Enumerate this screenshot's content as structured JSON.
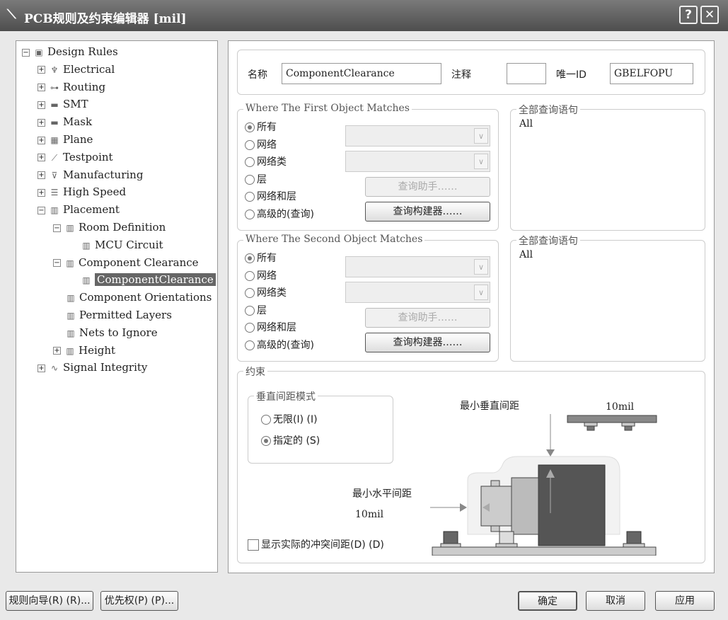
{
  "window": {
    "title": "PCB规则及约束编辑器 [mil]",
    "help": "?",
    "close": "✕"
  },
  "tree": [
    {
      "label": "Design Rules",
      "icon": "design-rules-icon",
      "level": 0,
      "exp": "−"
    },
    {
      "label": "Electrical",
      "icon": "electrical-icon",
      "level": 1,
      "exp": "+"
    },
    {
      "label": "Routing",
      "icon": "routing-icon",
      "level": 1,
      "exp": "+"
    },
    {
      "label": "SMT",
      "icon": "smt-icon",
      "level": 1,
      "exp": "+"
    },
    {
      "label": "Mask",
      "icon": "mask-icon",
      "level": 1,
      "exp": "+"
    },
    {
      "label": "Plane",
      "icon": "plane-icon",
      "level": 1,
      "exp": "+"
    },
    {
      "label": "Testpoint",
      "icon": "testpoint-icon",
      "level": 1,
      "exp": "+"
    },
    {
      "label": "Manufacturing",
      "icon": "manufacturing-icon",
      "level": 1,
      "exp": "+"
    },
    {
      "label": "High Speed",
      "icon": "high-speed-icon",
      "level": 1,
      "exp": "+"
    },
    {
      "label": "Placement",
      "icon": "placement-icon",
      "level": 1,
      "exp": "−"
    },
    {
      "label": "Room Definition",
      "icon": "chip-icon",
      "level": 2,
      "exp": "−"
    },
    {
      "label": "MCU Circuit",
      "icon": "chip-icon",
      "level": 3,
      "exp": ""
    },
    {
      "label": "Component Clearance",
      "icon": "chip-icon",
      "level": 2,
      "exp": "−"
    },
    {
      "label": "ComponentClearance",
      "icon": "chip-icon",
      "level": 3,
      "exp": "",
      "selected": true
    },
    {
      "label": "Component Orientations",
      "icon": "chip-icon",
      "level": 2,
      "exp": ""
    },
    {
      "label": "Permitted Layers",
      "icon": "chip-icon",
      "level": 2,
      "exp": ""
    },
    {
      "label": "Nets to Ignore",
      "icon": "chip-icon",
      "level": 2,
      "exp": ""
    },
    {
      "label": "Height",
      "icon": "chip-icon",
      "level": 2,
      "exp": "+"
    },
    {
      "label": "Signal Integrity",
      "icon": "signal-integrity-icon",
      "level": 1,
      "exp": "+"
    }
  ],
  "rule": {
    "name_label": "名称",
    "name": "ComponentClearance",
    "comment_label": "注释",
    "comment": "",
    "id_label": "唯一ID",
    "id": "GBELFOPU"
  },
  "first": {
    "title": "Where The First Object Matches",
    "options": [
      "所有",
      "网络",
      "网络类",
      "层",
      "网络和层",
      "高级的(查询)"
    ],
    "helper": "查询助手……",
    "builder": "查询构建器……",
    "query_title": "全部查询语句",
    "query": "All"
  },
  "second": {
    "title": "Where The Second Object Matches",
    "options": [
      "所有",
      "网络",
      "网络类",
      "层",
      "网络和层",
      "高级的(查询)"
    ],
    "helper": "查询助手……",
    "builder": "查询构建器……",
    "query_title": "全部查询语句",
    "query": "All"
  },
  "constraint": {
    "title": "约束",
    "mode_title": "垂直间距模式",
    "infinite": "无限(I) (I)",
    "specified": "指定的 (S)",
    "min_vertical": "最小垂直间距",
    "vertical_value": "10mil",
    "min_horizontal": "最小水平间距",
    "horizontal_value": "10mil",
    "show_actual": "显示实际的冲突间距(D) (D)"
  },
  "buttons": {
    "wizard": "规则向导(R) (R)...",
    "priority": "优先权(P) (P)...",
    "ok": "确定",
    "cancel": "取消",
    "apply": "应用"
  }
}
